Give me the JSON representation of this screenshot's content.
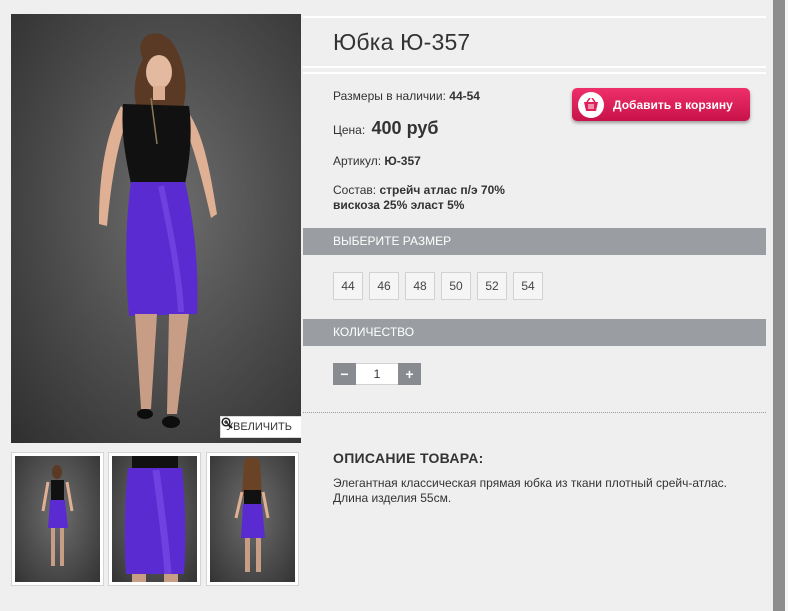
{
  "product": {
    "title": "Юбка Ю-357",
    "sizes_label": "Размеры в наличии:",
    "sizes_value": "44-54",
    "price_label": "Цена:",
    "price_value": "400 руб",
    "sku_label": "Артикул:",
    "sku_value": "Ю-357",
    "composition_label": "Состав:",
    "composition_line1": "стрейч атлас п/э 70%",
    "composition_line2": "вискоза 25% эласт 5%"
  },
  "cart_button": {
    "label": "Добавить в корзину",
    "icon": "basket-icon",
    "color": "#e0215b"
  },
  "size_section": {
    "heading": "ВЫБЕРИТЕ РАЗМЕР",
    "options": [
      "44",
      "46",
      "48",
      "50",
      "52",
      "54"
    ]
  },
  "quantity_section": {
    "heading": "КОЛИЧЕСТВО",
    "minus": "−",
    "plus": "+",
    "value": "1"
  },
  "gallery": {
    "zoom_label": "УВЕЛИЧИТЬ",
    "zoom_icon": "magnifier-plus-icon",
    "skirt_color": "#5a2bd0"
  },
  "description": {
    "heading": "ОПИСАНИЕ ТОВАРА:",
    "text": "Элегантная классическая прямая юбка из ткани плотный срейч-атлас. Длина изделия 55см."
  },
  "colors": {
    "section_bar": "#9a9ea2",
    "page_bg": "#efefef"
  }
}
